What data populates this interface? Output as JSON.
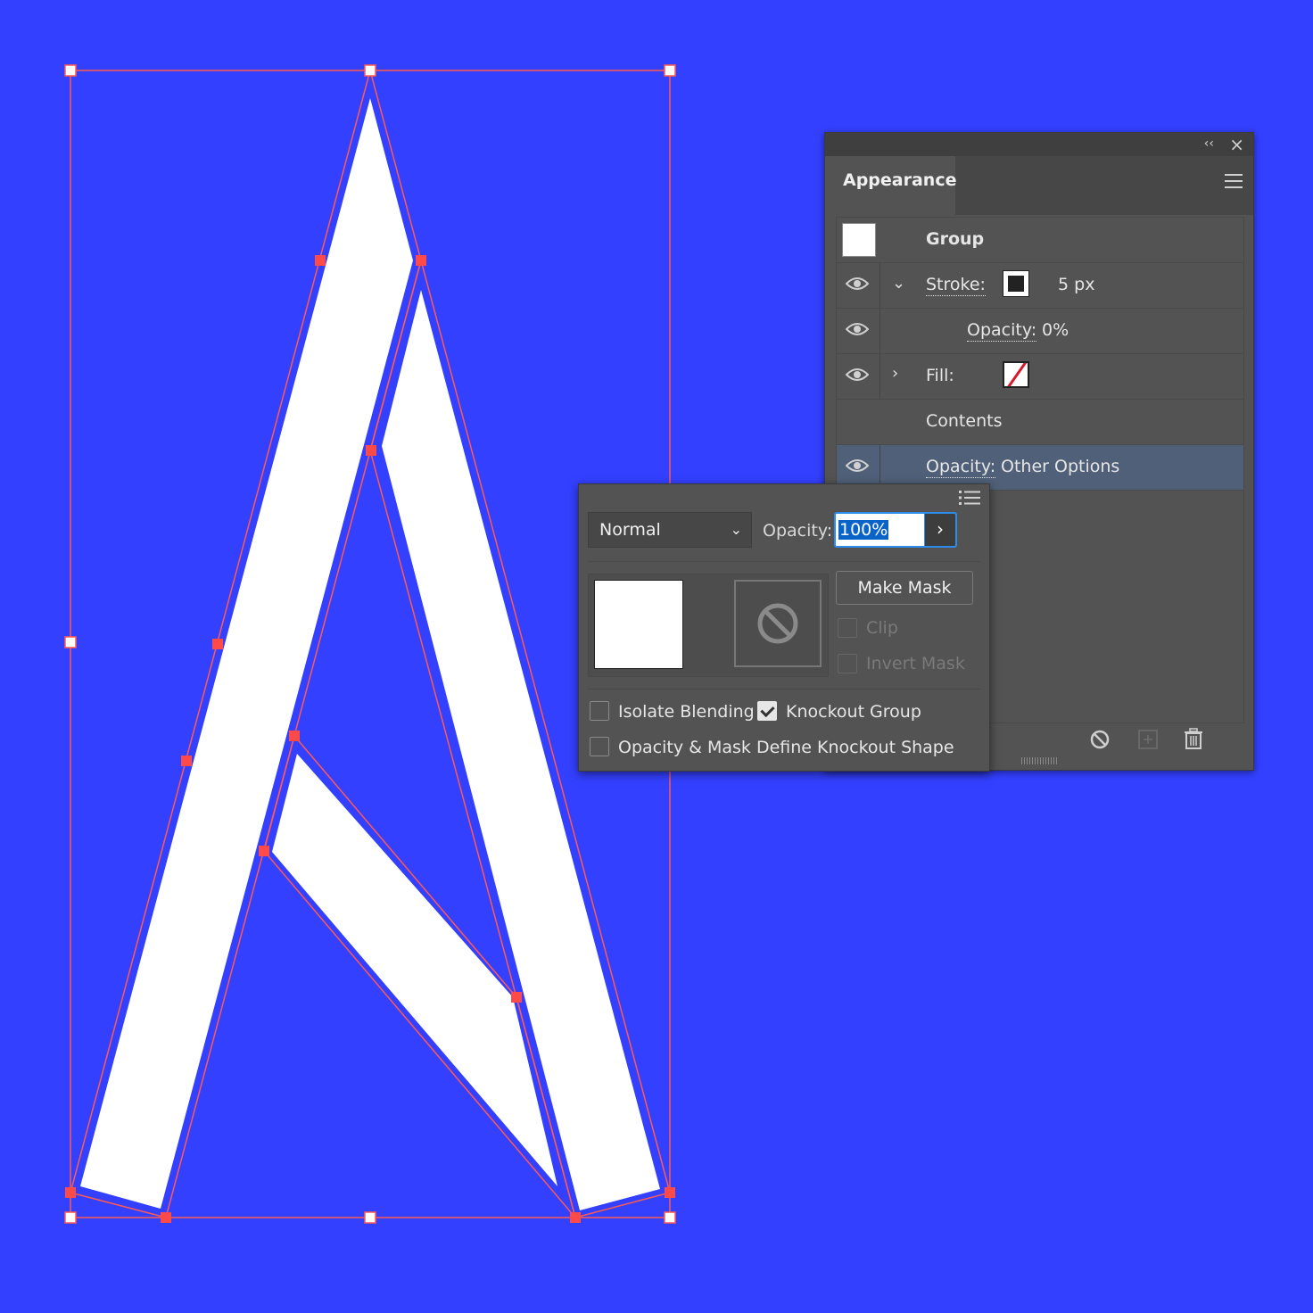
{
  "canvas": {
    "background_color": "#3340ff",
    "selection_color": "#ff5a4f",
    "shape_fill": "#ffffff"
  },
  "appearance_panel": {
    "tab_label": "Appearance",
    "collapse_icon": "double-chevron-left-icon",
    "close_icon": "close-icon",
    "menu_icon": "hamburger-menu-icon",
    "rows": {
      "group": {
        "label": "Group"
      },
      "stroke": {
        "label": "Stroke:",
        "value": "5 px",
        "swatch_color": "#222222"
      },
      "stroke_opacity": {
        "label": "Opacity:",
        "value": "0%"
      },
      "fill": {
        "label": "Fill:",
        "swatch": "none",
        "swatch_slash_color": "#d51a2c"
      },
      "contents": {
        "label": "Contents"
      },
      "opacity": {
        "label": "Opacity:",
        "value": "Other Options"
      }
    },
    "selected_row_color": "#4f6078",
    "footer_icons": [
      "clear-appearance-icon",
      "new-item-icon",
      "trash-icon"
    ]
  },
  "transparency_popup": {
    "blend_mode": "Normal",
    "opacity_label": "Opacity:",
    "opacity_value": "100%",
    "make_mask_label": "Make Mask",
    "clip_label": "Clip",
    "invert_mask_label": "Invert Mask",
    "isolate_blending_label": "Isolate Blending",
    "isolate_blending_checked": false,
    "knockout_group_label": "Knockout Group",
    "knockout_group_checked": true,
    "opacity_mask_label": "Opacity & Mask Define Knockout Shape",
    "opacity_mask_checked": false,
    "focus_color": "#2d8ceb"
  }
}
